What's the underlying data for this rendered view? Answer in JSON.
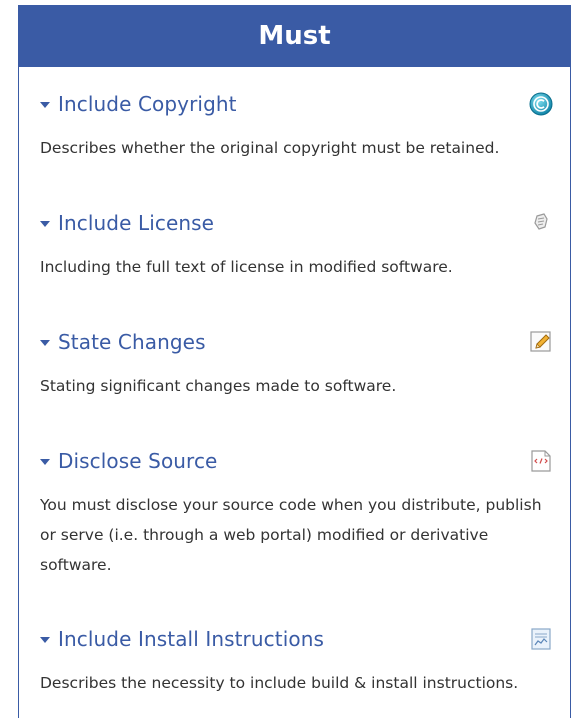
{
  "header": {
    "title": "Must"
  },
  "items": [
    {
      "title": "Include Copyright",
      "icon": "copyright-icon",
      "description": "Describes whether the original copyright must be retained."
    },
    {
      "title": "Include License",
      "icon": "license-icon",
      "description": "Including the full text of license in modified software."
    },
    {
      "title": "State Changes",
      "icon": "pencil-icon",
      "description": "Stating significant changes made to software."
    },
    {
      "title": "Disclose Source",
      "icon": "code-file-icon",
      "description": "You must disclose your source code when you distribute, publish or serve (i.e. through a web portal) modified or derivative software."
    },
    {
      "title": "Include Install Instructions",
      "icon": "install-doc-icon",
      "description": "Describes the necessity to include build & install instructions."
    }
  ],
  "colors": {
    "accent": "#3a5ba5",
    "text": "#333333"
  }
}
